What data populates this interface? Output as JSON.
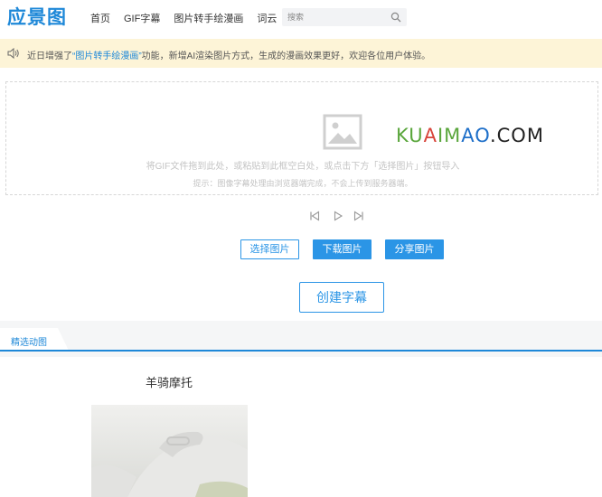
{
  "header": {
    "logo_text": "应景图",
    "nav": [
      "首页",
      "GIF字幕",
      "图片转手绘漫画",
      "词云"
    ],
    "search_placeholder": "搜索"
  },
  "notice": {
    "prefix": "近日增强了",
    "link": "“图片转手绘漫画”",
    "suffix": "功能，新增AI渲染图片方式，生成的漫画效果更好，欢迎各位用户体验。"
  },
  "dropzone": {
    "watermark": {
      "a": "KU",
      "b": "A",
      "c": "IM",
      "d": "AO",
      "e": ".COM"
    },
    "hint": "将GIF文件拖到此处，或粘贴到此框空白处，或点击下方「选择图片」按钮导入",
    "tip": "提示：图像字幕处理由浏览器端完成，不会上传到服务器端。"
  },
  "buttons": {
    "select": "选择图片",
    "download": "下载图片",
    "share": "分享图片",
    "create": "创建字幕"
  },
  "tabs": [
    "精选动图"
  ],
  "featured": {
    "title": "羊骑摩托"
  },
  "colors": {
    "accent": "#2b95e6",
    "notice_bg": "#fdf4d7"
  }
}
